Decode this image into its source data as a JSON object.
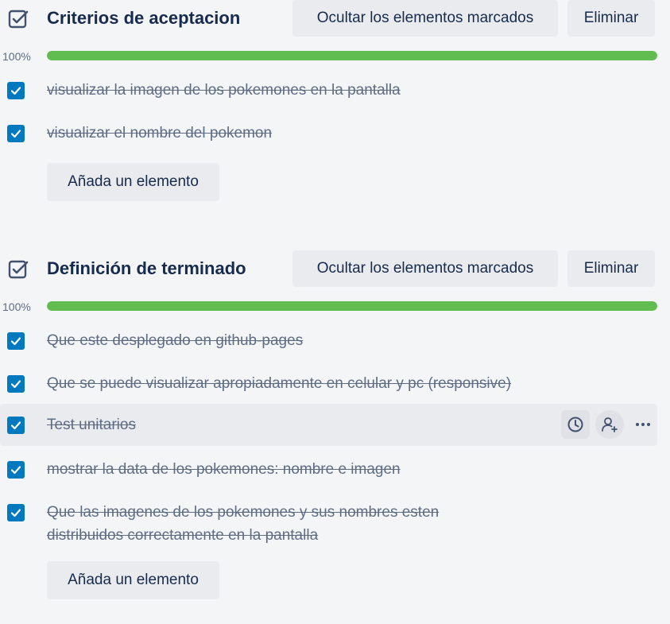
{
  "checklists": [
    {
      "title": "Criterios de aceptacion",
      "hide_checked_label": "Ocultar los elementos marcados",
      "delete_label": "Eliminar",
      "progress_label": "100%",
      "progress_fraction": 1.0,
      "items": [
        {
          "text": "visualizar la imagen de los pokemones en la pantalla",
          "checked": true
        },
        {
          "text": "visualizar el nombre del pokemon",
          "checked": true
        }
      ],
      "add_item_label": "Añada un elemento"
    },
    {
      "title": "Definición de terminado",
      "hide_checked_label": "Ocultar los elementos marcados",
      "delete_label": "Eliminar",
      "progress_label": "100%",
      "progress_fraction": 1.0,
      "items": [
        {
          "text": "Que este desplegado en github-pages",
          "checked": true
        },
        {
          "text": "Que se puede visualizar apropiadamente en celular y pc (responsive)",
          "checked": true
        },
        {
          "text": "Test unitarios",
          "checked": true,
          "hovered": true
        },
        {
          "text": "mostrar la data de los pokemones: nombre e imagen",
          "checked": true
        },
        {
          "text": "Que las imagenes de los pokemones y sus nombres esten",
          "text_line2": "distribuidos correctamente en la pantalla",
          "checked": true
        }
      ],
      "add_item_label": "Añada un elemento"
    }
  ],
  "item_actions": {
    "icons": [
      "clock-icon",
      "add-member-icon",
      "more-icon"
    ]
  },
  "colors": {
    "background": "#f4f5f7",
    "checkbox": "#0079bf",
    "progress": "#61bd4f",
    "button_bg": "#e9ebee",
    "title_text": "#172b4d",
    "muted_text": "#5e6c84"
  }
}
